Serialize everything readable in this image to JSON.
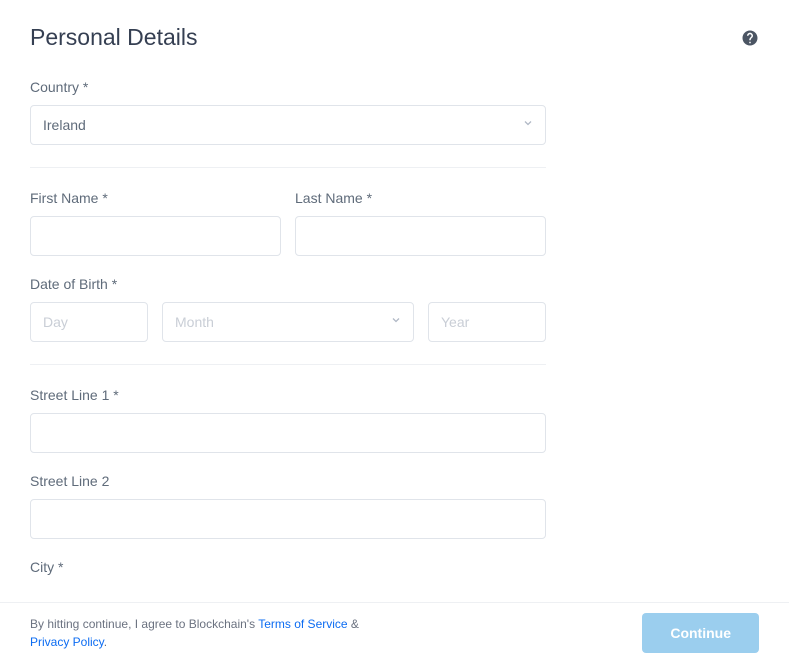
{
  "header": {
    "title": "Personal Details"
  },
  "fields": {
    "country": {
      "label": "Country *",
      "value": "Ireland"
    },
    "firstName": {
      "label": "First Name *",
      "value": ""
    },
    "lastName": {
      "label": "Last Name *",
      "value": ""
    },
    "dob": {
      "label": "Date of Birth *",
      "dayPlaceholder": "Day",
      "monthPlaceholder": "Month",
      "yearPlaceholder": "Year"
    },
    "street1": {
      "label": "Street Line 1 *",
      "value": ""
    },
    "street2": {
      "label": "Street Line 2",
      "value": ""
    },
    "city": {
      "label": "City *",
      "value": ""
    }
  },
  "footer": {
    "textPrefix": "By hitting continue, I agree to Blockchain's ",
    "tosLabel": "Terms of Service",
    "amp": " & ",
    "privacyLabel": "Privacy Policy",
    "period": ".",
    "continueLabel": "Continue"
  }
}
